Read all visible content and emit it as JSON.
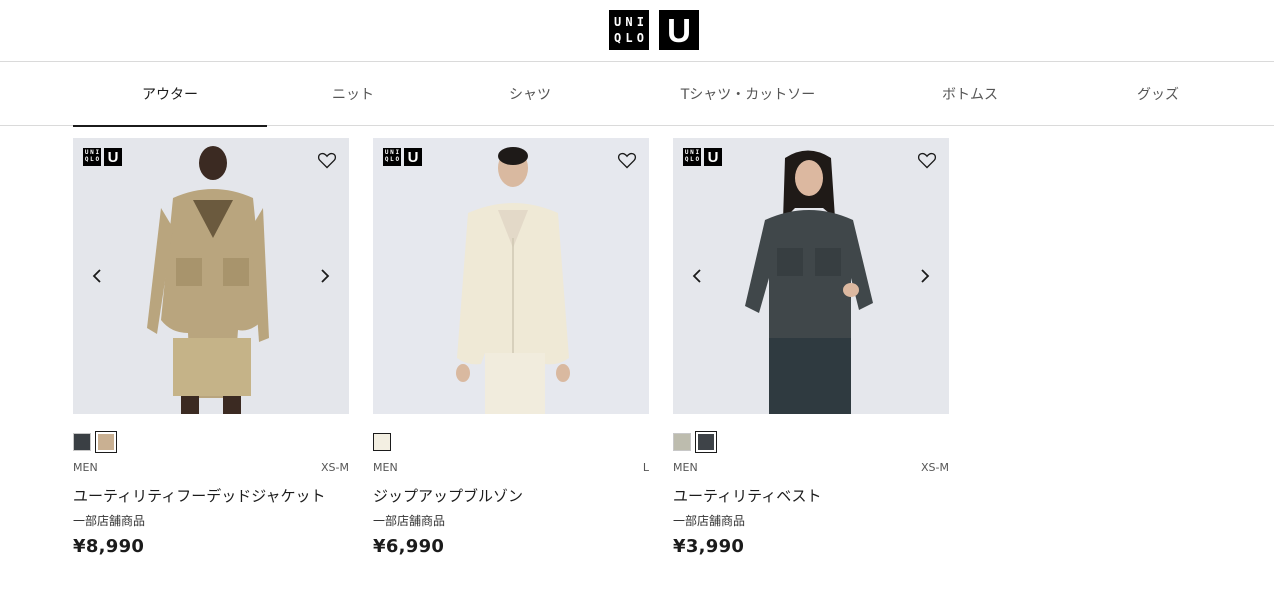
{
  "header": {
    "logo_uniqlo": [
      "U",
      "N",
      "I",
      "Q",
      "L",
      "O"
    ],
    "logo_u": "U"
  },
  "tabs": [
    {
      "label": "アウター",
      "active": true
    },
    {
      "label": "ニット",
      "active": false
    },
    {
      "label": "シャツ",
      "active": false
    },
    {
      "label": "Tシャツ・カットソー",
      "active": false
    },
    {
      "label": "ボトムス",
      "active": false
    },
    {
      "label": "グッズ",
      "active": false
    }
  ],
  "products": [
    {
      "gender": "MEN",
      "size": "XS-M",
      "name": "ユーティリティフーデッドジャケット",
      "note": "一部店舗商品",
      "price": "¥8,990",
      "swatches": [
        "#3a3f44",
        "#c9b092"
      ],
      "selected_swatch": 1,
      "has_arrows": true
    },
    {
      "gender": "MEN",
      "size": "L",
      "name": "ジップアップブルゾン",
      "note": "一部店舗商品",
      "price": "¥6,990",
      "swatches": [
        "#f3efe2"
      ],
      "selected_swatch": -1,
      "has_arrows": false
    },
    {
      "gender": "MEN",
      "size": "XS-M",
      "name": "ユーティリティベスト",
      "note": "一部店舗商品",
      "price": "¥3,990",
      "swatches": [
        "#bdbcae",
        "#3e4348"
      ],
      "selected_swatch": 1,
      "has_arrows": true
    }
  ],
  "colors": {
    "accent": "#1b1b1b",
    "divider": "#dadada",
    "photo_bg": "#e6e8ec"
  }
}
